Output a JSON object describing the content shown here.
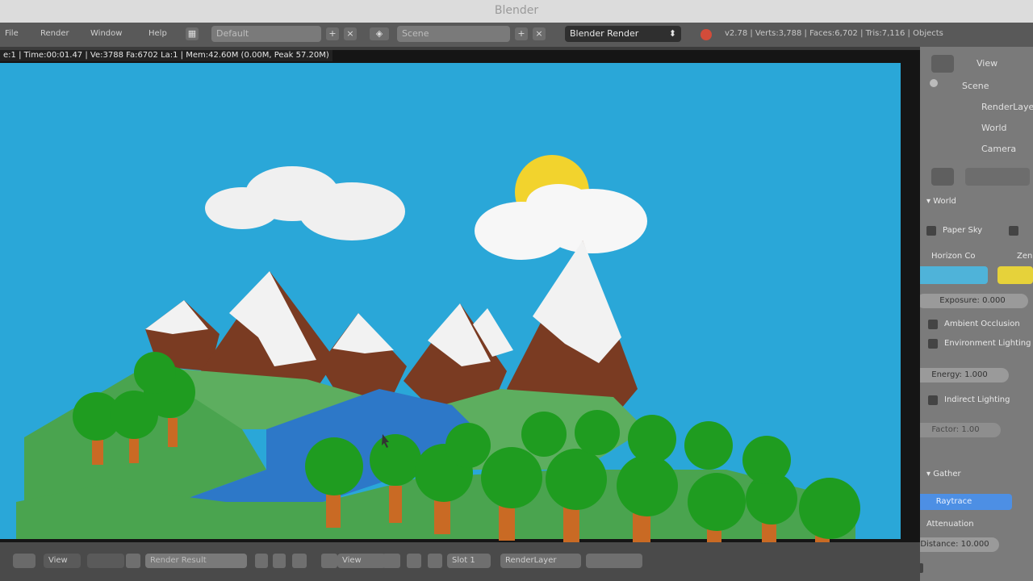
{
  "window": {
    "title": "Blender"
  },
  "menubar": {
    "items": [
      "File",
      "Render",
      "Window",
      "Help"
    ],
    "layout_value": "Default",
    "scene_value": "Scene",
    "render_engine": "Blender Render",
    "stats": "v2.78 | Verts:3,788 | Faces:6,702 | Tris:7,116 | Objects"
  },
  "render_overlay": {
    "text": "e:1 | Time:00:01.47 | Ve:3788 Fa:6702 La:1 | Mem:42.60M (0.00M, Peak 57.20M)"
  },
  "bottombar": {
    "image_name": "Render Result",
    "view_label": "View",
    "slot_label": "Slot 1",
    "layer_label": "RenderLayer"
  },
  "outliner": {
    "items": [
      "Scene",
      "RenderLayers",
      "World",
      "Camera"
    ],
    "view_label": "View"
  },
  "properties": {
    "section_world": "World",
    "paper_sky": "Paper Sky",
    "horizon_color_label": "Horizon Co",
    "zenith_color_label": "Zenith",
    "exposure": "Exposure: 0.000",
    "ambient_occlusion": "Ambient Occlusion",
    "environment_lighting": "Environment Lighting",
    "energy": "Energy:   1.000",
    "indirect_lighting": "Indirect Lighting",
    "factor": "Factor:   1.00",
    "gather_section": "Gather",
    "raytrace": "Raytrace",
    "attenuation": "Attenuation",
    "distance": "Distance: 10.000",
    "colors": {
      "horizon": "#4fb3d9",
      "zenith": "#e6d23a"
    }
  },
  "scene_colors": {
    "sky": "#2aa7d8",
    "cloud": "#f0f0f0",
    "sun": "#f2d32d",
    "snow": "#f2f2f2",
    "rock": "#7a3b22",
    "grass": "#4aa44f",
    "water": "#2d78c8",
    "tree": "#1f9c20",
    "trunk": "#c96a24"
  }
}
